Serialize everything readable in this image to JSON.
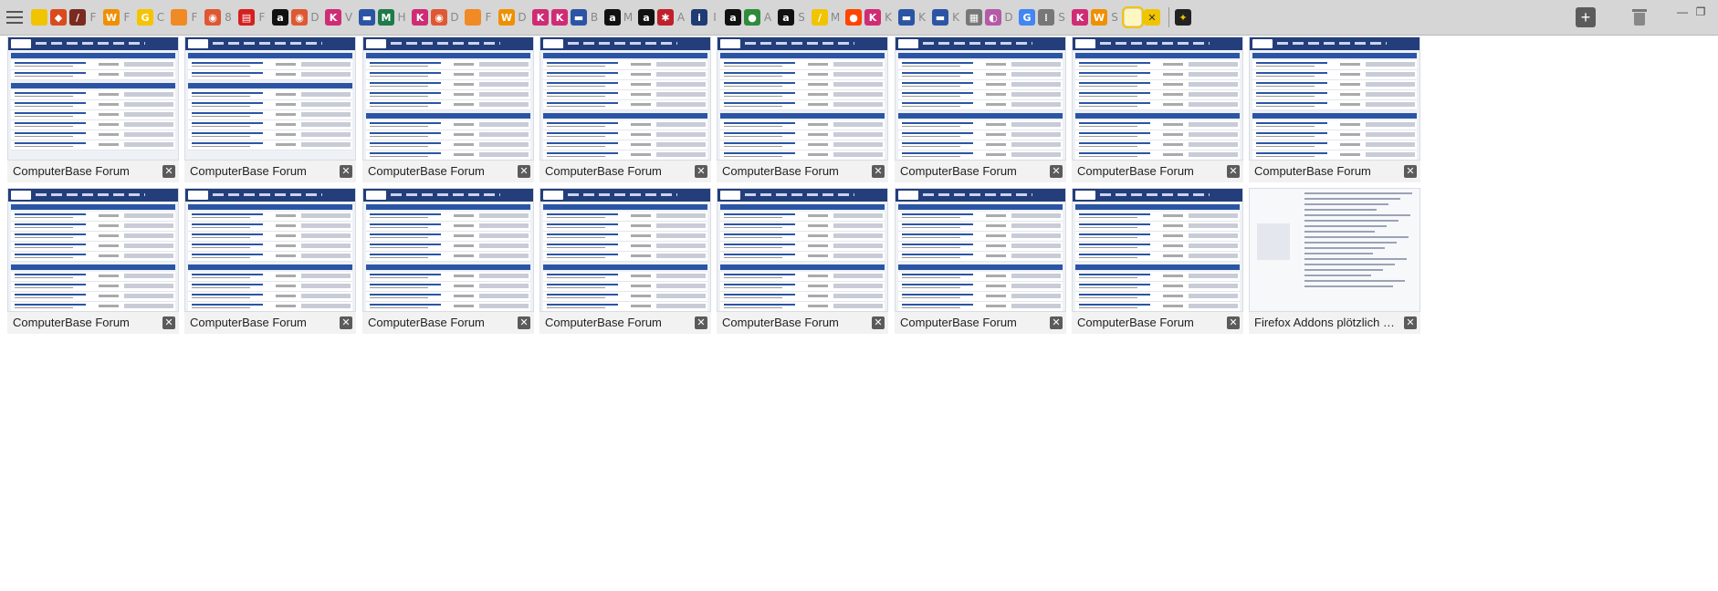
{
  "tabstrip": {
    "pinned": [
      {
        "icon": "cb-icon",
        "glyph": "",
        "color": "#f1c400"
      },
      {
        "icon": "puzzle-icon",
        "glyph": "◆",
        "color": "#d94a1e"
      },
      {
        "icon": "blocked-icon",
        "glyph": "/",
        "color": "#7a2a20"
      },
      {
        "icon": "f-dim",
        "glyph": "F",
        "color": "transparent",
        "dim": true
      },
      {
        "icon": "w-icon",
        "glyph": "W",
        "color": "#f09000"
      },
      {
        "icon": "f-dim2",
        "glyph": "F",
        "color": "transparent",
        "dim": true
      },
      {
        "icon": "g-icon",
        "glyph": "G",
        "color": "#f5c400"
      },
      {
        "icon": "c-dim",
        "glyph": "C",
        "color": "transparent",
        "dim": true
      },
      {
        "icon": "orange-icon",
        "glyph": "",
        "color": "#f08a24"
      },
      {
        "icon": "f-dim3",
        "glyph": "F",
        "color": "transparent",
        "dim": true
      },
      {
        "icon": "duck-icon",
        "glyph": "◉",
        "color": "#de5833"
      },
      {
        "icon": "m-dim",
        "glyph": "8",
        "color": "transparent",
        "dim": true
      },
      {
        "icon": "stripe-icon",
        "glyph": "▤",
        "color": "#d42020"
      },
      {
        "icon": "f-dim4",
        "glyph": "F",
        "color": "transparent",
        "dim": true
      },
      {
        "icon": "amazon-icon",
        "glyph": "a",
        "color": "#111111"
      },
      {
        "icon": "duck2-icon",
        "glyph": "◉",
        "color": "#de5833"
      },
      {
        "icon": "d-dim",
        "glyph": "D",
        "color": "transparent",
        "dim": true
      },
      {
        "icon": "k-icon",
        "glyph": "K",
        "color": "#d02c75"
      },
      {
        "icon": "v-dim",
        "glyph": "V",
        "color": "transparent",
        "dim": true
      },
      {
        "icon": "bar-icon",
        "glyph": "▬",
        "color": "#2b55a4"
      },
      {
        "icon": "m-icon",
        "glyph": "M",
        "color": "#1f7a4a"
      },
      {
        "icon": "h-dim",
        "glyph": "H",
        "color": "transparent",
        "dim": true
      },
      {
        "icon": "k2-icon",
        "glyph": "K",
        "color": "#d02c75"
      },
      {
        "icon": "duck3-icon",
        "glyph": "◉",
        "color": "#de5833"
      },
      {
        "icon": "d-dim2",
        "glyph": "D",
        "color": "transparent",
        "dim": true
      },
      {
        "icon": "orange2-icon",
        "glyph": "",
        "color": "#f08a24"
      },
      {
        "icon": "f-dim5",
        "glyph": "F",
        "color": "transparent",
        "dim": true
      },
      {
        "icon": "w2-icon",
        "glyph": "W",
        "color": "#f09000"
      },
      {
        "icon": "d-dim3",
        "glyph": "D",
        "color": "transparent",
        "dim": true
      },
      {
        "icon": "k3-icon",
        "glyph": "K",
        "color": "#d02c75"
      },
      {
        "icon": "k4-icon",
        "glyph": "K",
        "color": "#d02c75"
      },
      {
        "icon": "bar2-icon",
        "glyph": "▬",
        "color": "#2b55a4"
      },
      {
        "icon": "b-dim",
        "glyph": "B",
        "color": "transparent",
        "dim": true
      },
      {
        "icon": "amazon2-icon",
        "glyph": "a",
        "color": "#111111"
      },
      {
        "icon": "m-dim2",
        "glyph": "M",
        "color": "transparent",
        "dim": true
      },
      {
        "icon": "amazon3-icon",
        "glyph": "a",
        "color": "#111111"
      },
      {
        "icon": "bug-icon",
        "glyph": "✱",
        "color": "#c0202a"
      },
      {
        "icon": "a-dim",
        "glyph": "A",
        "color": "transparent",
        "dim": true
      },
      {
        "icon": "info-icon",
        "glyph": "i",
        "color": "#1f3b73"
      },
      {
        "icon": "i-dim",
        "glyph": "I",
        "color": "transparent",
        "dim": true
      },
      {
        "icon": "amazon4-icon",
        "glyph": "a",
        "color": "#111111"
      },
      {
        "icon": "frog-icon",
        "glyph": "●",
        "color": "#2e8b3a"
      },
      {
        "icon": "a-dim2",
        "glyph": "A",
        "color": "transparent",
        "dim": true
      },
      {
        "icon": "amazon5-icon",
        "glyph": "a",
        "color": "#111111"
      },
      {
        "icon": "s-dim",
        "glyph": "S",
        "color": "transparent",
        "dim": true
      },
      {
        "icon": "feather-icon",
        "glyph": "/",
        "color": "#f1c400"
      },
      {
        "icon": "m-dim3",
        "glyph": "M",
        "color": "transparent",
        "dim": true
      },
      {
        "icon": "reddit-icon",
        "glyph": "●",
        "color": "#ff4500"
      },
      {
        "icon": "k5-icon",
        "glyph": "K",
        "color": "#d02c75"
      },
      {
        "icon": "k-dim",
        "glyph": "K",
        "color": "transparent",
        "dim": true
      },
      {
        "icon": "bar3-icon",
        "glyph": "▬",
        "color": "#2b55a4"
      },
      {
        "icon": "k-dim2",
        "glyph": "K",
        "color": "transparent",
        "dim": true
      },
      {
        "icon": "bar4-icon",
        "glyph": "▬",
        "color": "#2b55a4"
      },
      {
        "icon": "k-dim3",
        "glyph": "K",
        "color": "transparent",
        "dim": true
      },
      {
        "icon": "grid-icon",
        "glyph": "▦",
        "color": "#777777"
      },
      {
        "icon": "photo-icon",
        "glyph": "◐",
        "color": "#b55aa8"
      },
      {
        "icon": "d-dim4",
        "glyph": "D",
        "color": "transparent",
        "dim": true
      },
      {
        "icon": "google-icon",
        "glyph": "G",
        "color": "#4285f4"
      },
      {
        "icon": "apps-icon",
        "glyph": "⁞",
        "color": "#777777"
      },
      {
        "icon": "s-dim2",
        "glyph": "S",
        "color": "transparent",
        "dim": true
      },
      {
        "icon": "k6-icon",
        "glyph": "K",
        "color": "#d02c75"
      },
      {
        "icon": "w3-icon",
        "glyph": "W",
        "color": "#f09000"
      },
      {
        "icon": "s-dim3",
        "glyph": "S",
        "color": "transparent",
        "dim": true
      },
      {
        "icon": "cb2-icon",
        "glyph": "",
        "color": "#2b55a4",
        "active": true
      }
    ],
    "close_active": "✕",
    "ff_icon": "fire",
    "new_tab": "+"
  },
  "tabs": [
    {
      "title": "ComputerBase Forum",
      "kind": "index"
    },
    {
      "title": "ComputerBase Forum",
      "kind": "index"
    },
    {
      "title": "ComputerBase Forum",
      "kind": "forum"
    },
    {
      "title": "ComputerBase Forum",
      "kind": "forum"
    },
    {
      "title": "ComputerBase Forum",
      "kind": "forum"
    },
    {
      "title": "ComputerBase Forum",
      "kind": "forum"
    },
    {
      "title": "ComputerBase Forum",
      "kind": "forum"
    },
    {
      "title": "ComputerBase Forum",
      "kind": "forum"
    },
    {
      "title": "ComputerBase Forum",
      "kind": "forum"
    },
    {
      "title": "ComputerBase Forum",
      "kind": "forum"
    },
    {
      "title": "ComputerBase Forum",
      "kind": "forum"
    },
    {
      "title": "ComputerBase Forum",
      "kind": "forum"
    },
    {
      "title": "ComputerBase Forum",
      "kind": "forum"
    },
    {
      "title": "ComputerBase Forum",
      "kind": "forum"
    },
    {
      "title": "ComputerBase Forum",
      "kind": "forum"
    },
    {
      "title": "Firefox Addons plötzlich deaktiv...",
      "kind": "post"
    }
  ],
  "close_glyph": "✕"
}
